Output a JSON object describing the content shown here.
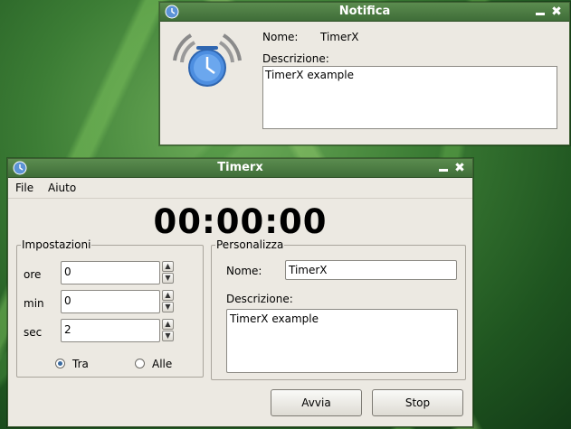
{
  "notifica": {
    "title": "Notifica",
    "name_label": "Nome:",
    "name_value": "TimerX",
    "desc_label": "Descrizione:",
    "desc_value": "TimerX example",
    "min_icon": "minimize-icon",
    "close_icon": "close-icon"
  },
  "timerx": {
    "title": "Timerx",
    "menu": [
      "File",
      "Aiuto"
    ],
    "time": "00:00:00",
    "impostazioni": {
      "legend": "Impostazioni",
      "rows": [
        {
          "label": "ore",
          "value": "0"
        },
        {
          "label": "min",
          "value": "0"
        },
        {
          "label": "sec",
          "value": "2"
        }
      ],
      "radio_tra": "Tra",
      "radio_alle": "Alle",
      "selected": "Tra"
    },
    "personalizza": {
      "legend": "Personalizza",
      "name_label": "Nome:",
      "name_value": "TimerX",
      "desc_label": "Descrizione:",
      "desc_value": "TimerX example"
    },
    "buttons": {
      "start": "Avvia",
      "stop": "Stop"
    }
  },
  "colors": {
    "titlebar": "#4a7b42",
    "accent": "#3a6a9f",
    "window_bg": "#ece9e2"
  }
}
